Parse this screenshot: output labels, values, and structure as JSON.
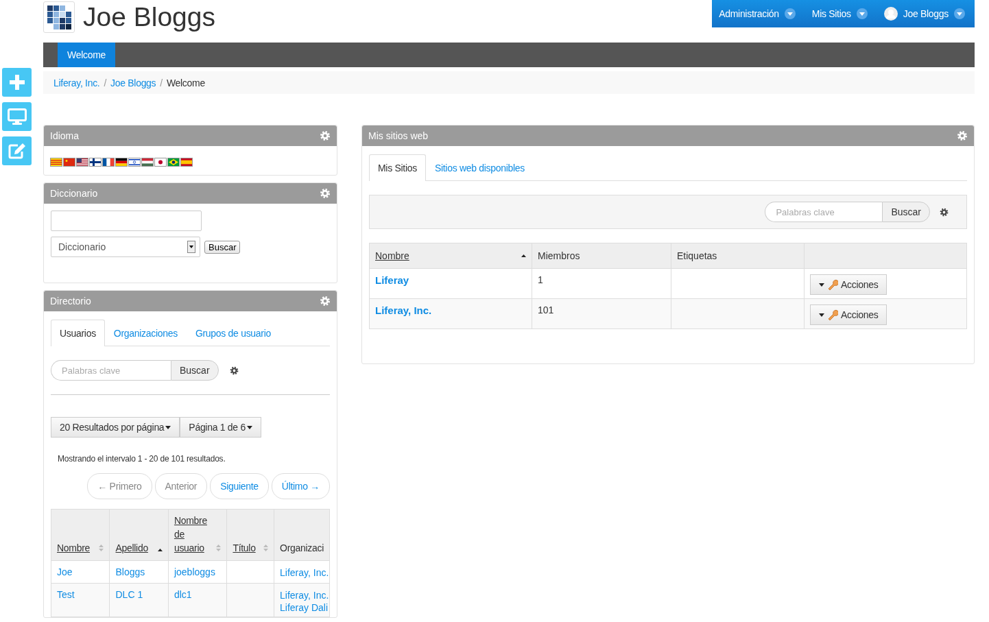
{
  "site": {
    "title": "Joe Bloggs"
  },
  "dockbar": [
    {
      "label": "Administración",
      "kind": "menu"
    },
    {
      "label": "Mis Sitios",
      "kind": "menu"
    },
    {
      "label": "Joe Bloggs",
      "kind": "user"
    }
  ],
  "nav": [
    {
      "label": "Welcome",
      "selected": true
    }
  ],
  "breadcrumb": [
    {
      "label": "Liferay, Inc.",
      "kind": "link"
    },
    {
      "label": "/",
      "kind": "separator"
    },
    {
      "label": "Joe Bloggs",
      "kind": "link"
    },
    {
      "label": "/",
      "kind": "separator"
    },
    {
      "label": "Welcome",
      "kind": "current"
    }
  ],
  "idioma": {
    "title": "Idioma"
  },
  "diccionario": {
    "title": "Diccionario",
    "select": "Diccionario",
    "button": "Buscar"
  },
  "directorio": {
    "title": "Directorio",
    "tabs": [
      {
        "label": "Usuarios",
        "selected": true
      },
      {
        "label": "Organizaciones",
        "selected": false
      },
      {
        "label": "Grupos de usuario",
        "selected": false
      }
    ],
    "search": {
      "placeholder": "Palabras clave",
      "button": "Buscar"
    },
    "page_size": "20 Resultados por página",
    "page": "Página 1 de 6",
    "summary": "Mostrando el intervalo 1 - 20 de 101 resultados.",
    "pager": [
      {
        "label": "← Primero",
        "disabled": true
      },
      {
        "label": "Anterior",
        "disabled": true
      },
      {
        "label": "Siguiente",
        "disabled": false
      },
      {
        "label": "Último →",
        "disabled": false
      }
    ],
    "table": {
      "columns": [
        {
          "label": "Nombre",
          "sortable": true,
          "sorted": false
        },
        {
          "label": "Apellido",
          "sortable": true,
          "sorted": true
        },
        {
          "label": "Nombre de usuario",
          "sortable": true,
          "sorted": false
        },
        {
          "label": "Título",
          "sortable": true,
          "sorted": false
        },
        {
          "label": "Organizaci",
          "sortable": false,
          "sorted": false
        }
      ],
      "rows": [
        {
          "first": "Joe",
          "last": "Bloggs",
          "user": "joebloggs",
          "orgs": [
            "Liferay, Inc."
          ]
        },
        {
          "first": "Test",
          "last": "DLC 1",
          "user": "dlc1",
          "orgs": [
            "Liferay, Inc.",
            "Liferay Dali"
          ]
        }
      ]
    }
  },
  "sitios": {
    "title": "Mis sitios web",
    "tabs": [
      {
        "label": "Mis Sitios",
        "selected": true
      },
      {
        "label": "Sitios web disponibles",
        "selected": false
      }
    ],
    "search": {
      "placeholder": "Palabras clave",
      "button": "Buscar"
    },
    "table": {
      "columns": [
        {
          "label": "Nombre",
          "sortable": true,
          "sorted": true
        },
        {
          "label": "Miembros",
          "sortable": false,
          "sorted": false
        },
        {
          "label": "Etiquetas",
          "sortable": false,
          "sorted": false
        }
      ],
      "rows": [
        {
          "name": "Liferay",
          "members": "1",
          "action": "Acciones"
        },
        {
          "name": "Liferay, Inc.",
          "members": "101",
          "action": "Acciones"
        }
      ]
    }
  }
}
